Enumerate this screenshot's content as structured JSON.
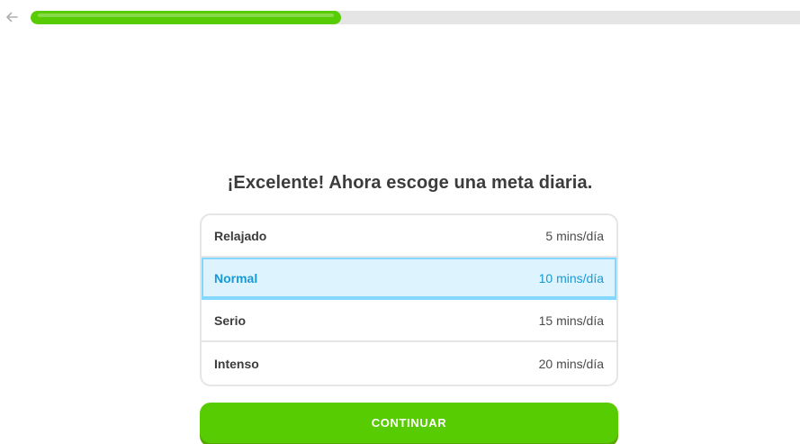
{
  "header": {
    "back_icon": "arrow-left-icon",
    "progress": 0.4,
    "colors": {
      "progress_fill": "#58cc02",
      "progress_track": "#e5e5e5"
    }
  },
  "title": "¡Excelente! Ahora escoge una meta diaria.",
  "goals": [
    {
      "name": "Relajado",
      "minutes": "5 mins/día",
      "selected": false
    },
    {
      "name": "Normal",
      "minutes": "10 mins/día",
      "selected": true
    },
    {
      "name": "Serio",
      "minutes": "15 mins/día",
      "selected": false
    },
    {
      "name": "Intenso",
      "minutes": "20 mins/día",
      "selected": false
    }
  ],
  "continue_label": "CONTINUAR",
  "colors": {
    "accent_green": "#58cc02",
    "selected_blue": "#1899d6",
    "selected_bg": "#ddf4ff"
  }
}
